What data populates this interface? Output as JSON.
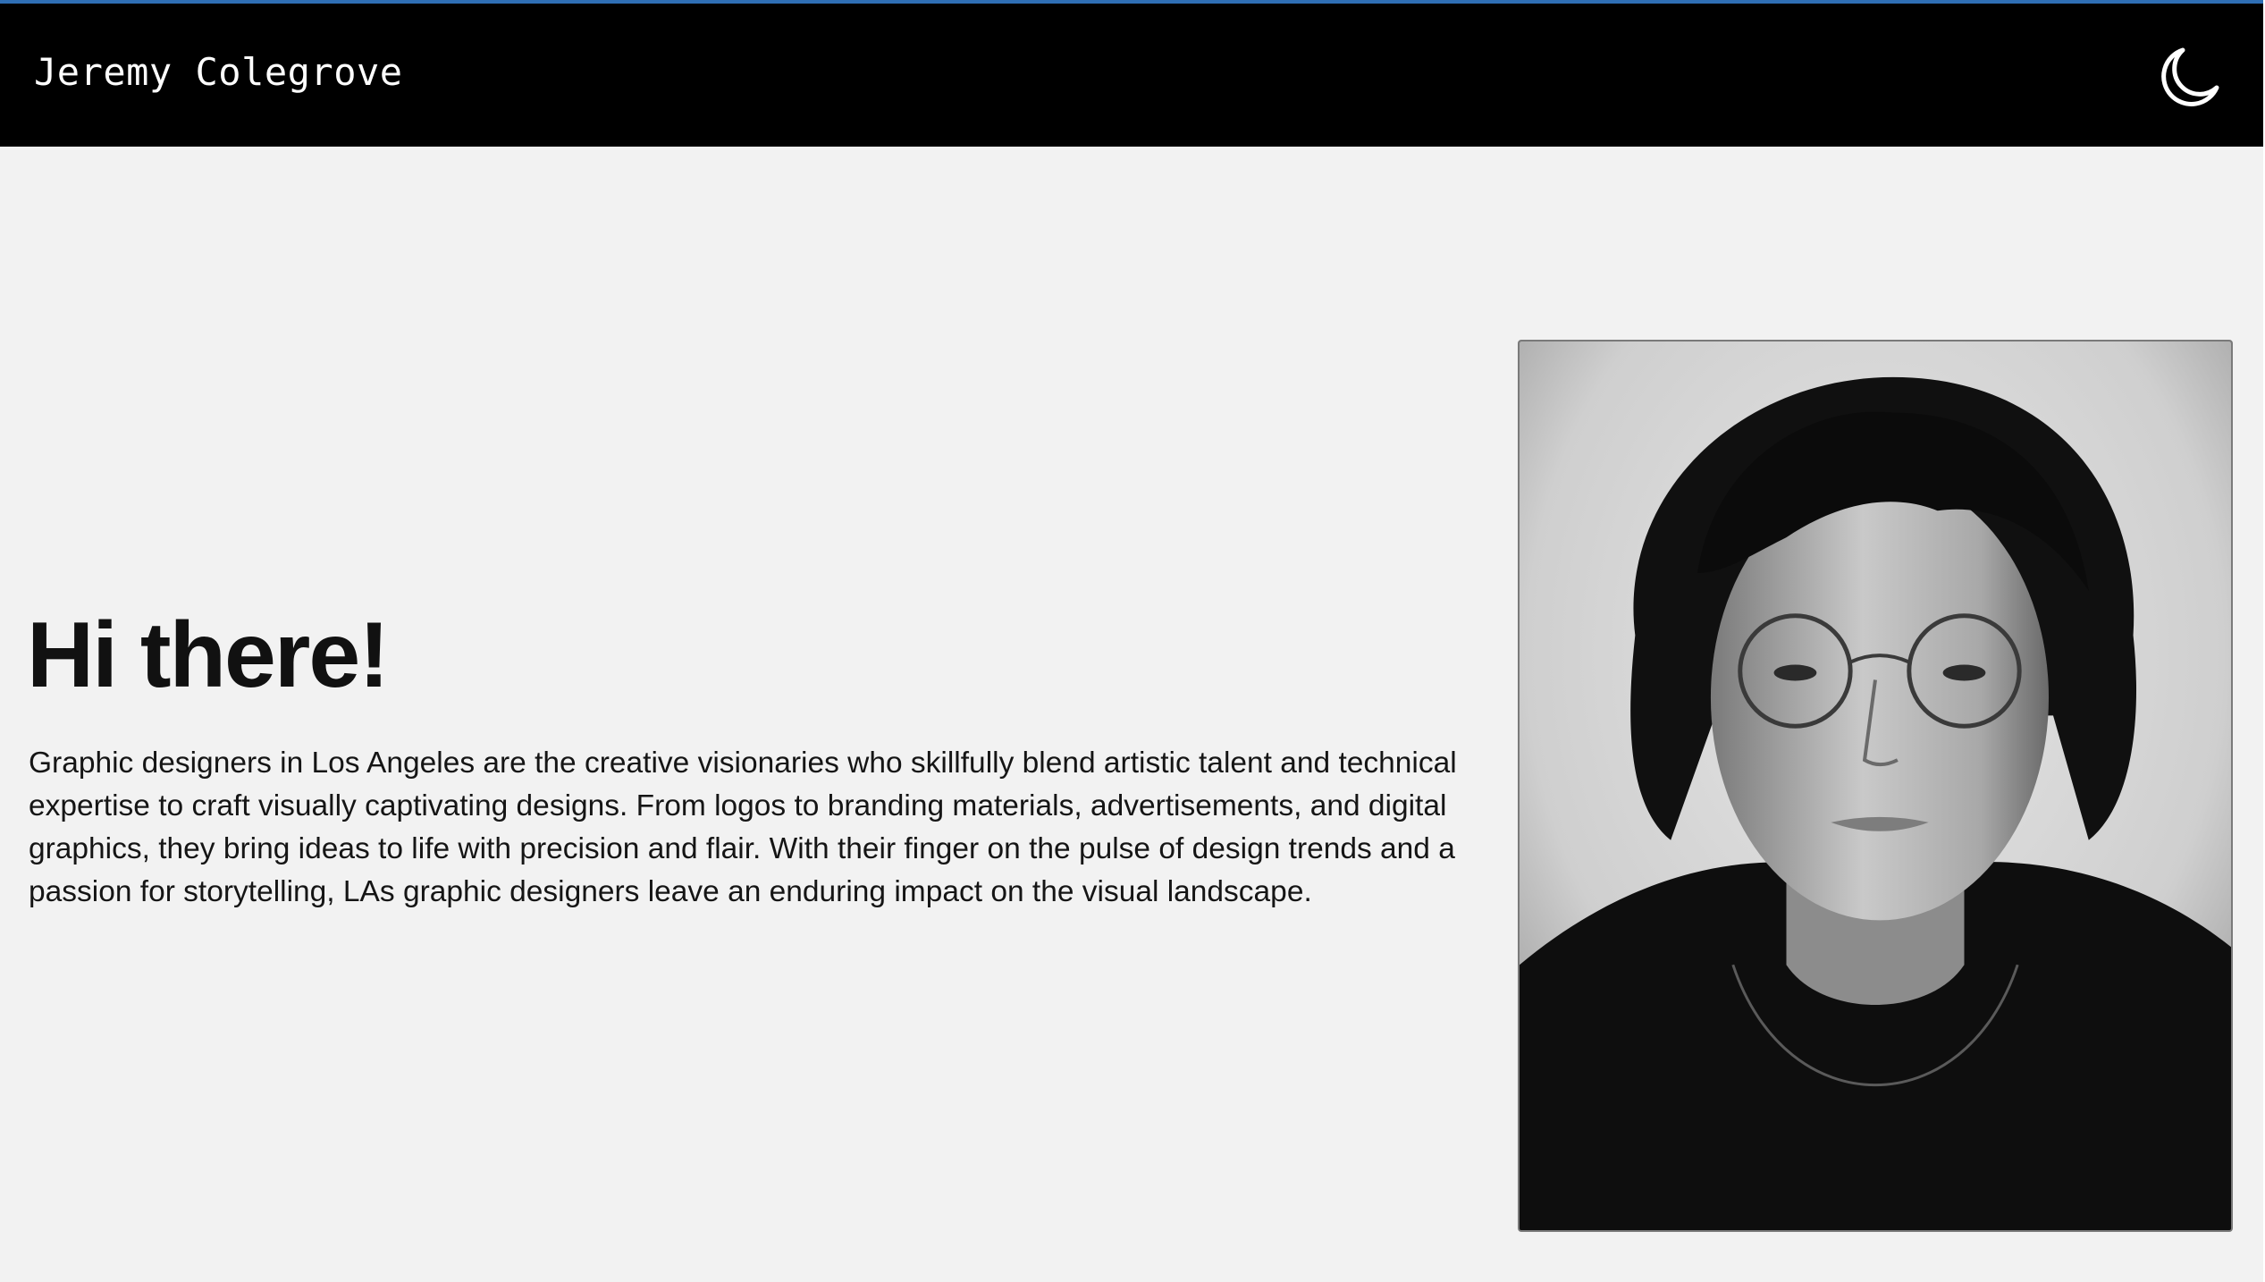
{
  "header": {
    "site_title": "Jeremy Colegrove",
    "theme_toggle_icon": "moon-icon",
    "background_color": "#000000",
    "accent_color": "#2f6fb5"
  },
  "hero": {
    "heading": "Hi there!",
    "body": "Graphic designers in Los Angeles are the creative visionaries who skillfully blend artistic talent and technical expertise to craft visually captivating designs. From logos to branding materials, advertisements, and digital graphics, they bring ideas to life with precision and flair. With their finger on the pulse of design trends and a passion for storytelling, LAs graphic designers leave an enduring impact on the visual landscape."
  },
  "portrait": {
    "icon": "portrait-photo",
    "style": "black-and-white"
  },
  "colors": {
    "page_background": "#f2f2f2",
    "text": "#111111"
  }
}
